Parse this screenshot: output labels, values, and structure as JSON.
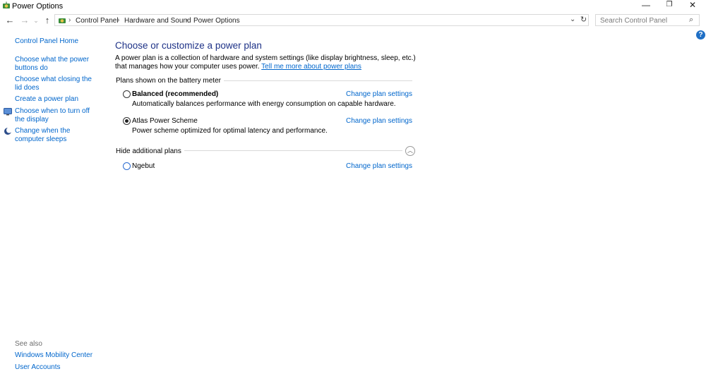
{
  "window": {
    "title": "Power Options",
    "icon": "power-options-icon",
    "controls": {
      "minimize": "—",
      "restore": "❐",
      "close": "✕"
    }
  },
  "nav": {
    "back": "←",
    "forward": "→",
    "history": "⌄",
    "up": "↑"
  },
  "address": {
    "crumbs": [
      "Control Panel",
      "Hardware and Sound",
      "Power Options"
    ],
    "separator": "›",
    "dropdown": "⌄",
    "refresh": "↻"
  },
  "search": {
    "placeholder": "Search Control Panel",
    "icon": "⌕"
  },
  "help": {
    "label": "?"
  },
  "sidebar": {
    "items": [
      {
        "label": "Control Panel Home"
      },
      {
        "label": "Choose what the power buttons do"
      },
      {
        "label": "Choose what closing the lid does"
      },
      {
        "label": "Create a power plan"
      },
      {
        "label": "Choose when to turn off the display"
      },
      {
        "label": "Change when the computer sleeps"
      }
    ],
    "see_also": {
      "label": "See also",
      "items": [
        {
          "label": "Windows Mobility Center"
        },
        {
          "label": "User Accounts"
        }
      ]
    }
  },
  "main": {
    "heading": "Choose or customize a power plan",
    "description": "A power plan is a collection of hardware and system settings (like display brightness, sleep, etc.) that manages how your computer uses power.",
    "learn_more": "Tell me more about power plans",
    "battery_section": "Plans shown on the battery meter",
    "plans": [
      {
        "name": "Balanced (recommended)",
        "description": "Automatically balances performance with energy consumption on capable hardware.",
        "selected": false,
        "change_label": "Change plan settings"
      },
      {
        "name": "Atlas Power Scheme",
        "description": "Power scheme optimized for optimal latency and performance.",
        "selected": true,
        "change_label": "Change plan settings"
      }
    ],
    "additional_section": "Hide additional plans",
    "collapse_glyph": "︿",
    "additional_plans": [
      {
        "name": "Ngebut",
        "selected": false,
        "change_label": "Change plan settings"
      }
    ]
  }
}
